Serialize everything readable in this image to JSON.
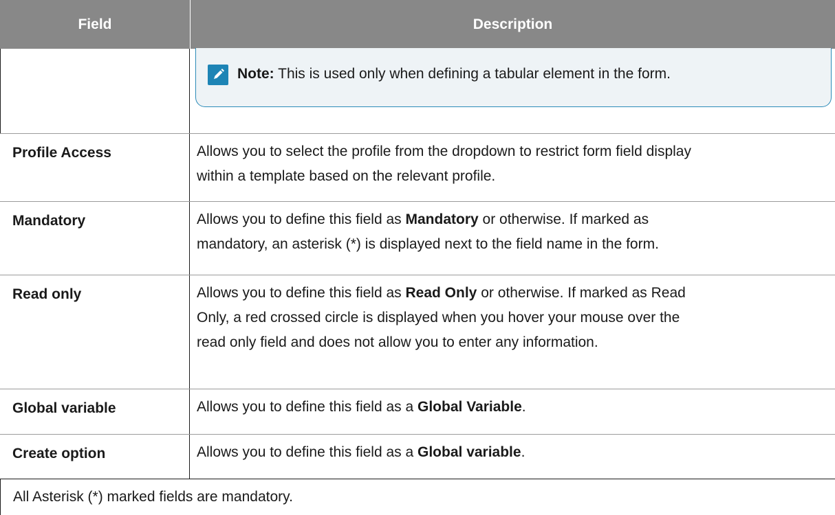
{
  "header": {
    "field": "Field",
    "description": "Description"
  },
  "note": {
    "label": "Note:",
    "text": " This is used only when defining a tabular element in the form."
  },
  "rows": [
    {
      "field": "Profile Access",
      "d1": "Allows you to select the profile from the dropdown to restrict form field display",
      "d2": "within a template based on the relevant profile."
    },
    {
      "field": "Mandatory",
      "d1a": "Allows you to define this field as ",
      "d1b": "Mandatory",
      "d1c": " or otherwise. If marked as",
      "d2": "mandatory, an asterisk (*) is displayed next to the field name in the form."
    },
    {
      "field": "Read only",
      "d1a": "Allows you to define this field as ",
      "d1b": "Read Only",
      "d1c": " or otherwise. If marked as Read",
      "d2": "Only, a red crossed circle is displayed when you hover your mouse over the",
      "d3": "read only field and does not allow you to enter any information."
    },
    {
      "field": "Global variable",
      "d1a": "Allows you to define this field as a ",
      "d1b": "Global Variable",
      "d1c": "."
    },
    {
      "field": "Create option",
      "d1a": "Allows you to define this field as a ",
      "d1b": "Global variable",
      "d1c": "."
    }
  ],
  "footer": "All Asterisk (*) marked fields are mandatory.",
  "colors": {
    "header_bg": "#888888",
    "note_bg": "#eef3f6",
    "note_border": "#2a8ab8",
    "icon": "#1d84b5"
  },
  "icons": {
    "note": "edit-pencil-icon"
  }
}
